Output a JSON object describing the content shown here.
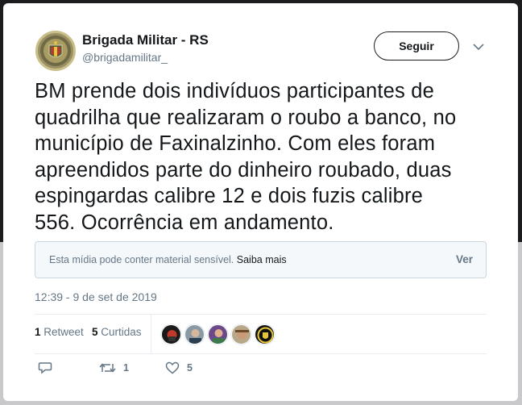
{
  "author": {
    "name": "Brigada Militar - RS",
    "handle": "@brigadamilitar_",
    "avatar_icon": "police-badge-icon"
  },
  "follow_button": {
    "label": "Seguir"
  },
  "tweet": {
    "lines": [
      "BM prende dois indivíduos participantes de",
      "quadrilha que realizaram o roubo a banco, no",
      "município de Faxinalzinho. Com eles foram",
      "apreendidos parte do dinheiro roubado, duas",
      "espingardas calibre 12 e dois fuzis calibre",
      "556. Ocorrência em andamento."
    ]
  },
  "sensitive_media": {
    "message": "Esta mídia pode conter material sensível.",
    "link": "Saiba mais",
    "button": "Ver"
  },
  "timestamp": "12:39 - 9 de set de 2019",
  "stats": {
    "retweets_count": "1",
    "retweets_label": "Retweet",
    "likes_count": "5",
    "likes_label": "Curtidas"
  },
  "actions": {
    "reply_icon": "reply-icon",
    "retweet_count": "1",
    "like_count": "5"
  },
  "colors": {
    "text": "#14171a",
    "secondary": "#657786",
    "border": "#ccd6dd",
    "retweet_green": "#17bf63"
  }
}
